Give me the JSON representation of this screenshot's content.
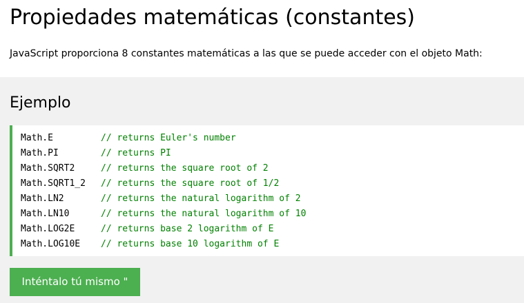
{
  "page": {
    "title": "Propiedades matemáticas (constantes)",
    "intro": "JavaScript proporciona 8 constantes matemáticas a las que se puede acceder con el objeto Math:"
  },
  "example": {
    "heading": "Ejemplo",
    "lines": [
      {
        "code": "Math.E",
        "comment": "// returns Euler's number"
      },
      {
        "code": "Math.PI",
        "comment": "// returns PI"
      },
      {
        "code": "Math.SQRT2",
        "comment": "// returns the square root of 2"
      },
      {
        "code": "Math.SQRT1_2",
        "comment": "// returns the square root of 1/2"
      },
      {
        "code": "Math.LN2",
        "comment": "// returns the natural logarithm of 2"
      },
      {
        "code": "Math.LN10",
        "comment": "// returns the natural logarithm of 10"
      },
      {
        "code": "Math.LOG2E",
        "comment": "// returns base 2 logarithm of E"
      },
      {
        "code": "Math.LOG10E",
        "comment": "// returns base 10 logarithm of E"
      }
    ],
    "button_label": "Inténtalo tú mismo \""
  },
  "colors": {
    "accent": "#4caf50",
    "comment": "#008000",
    "panel_background": "#f1f1f1"
  }
}
